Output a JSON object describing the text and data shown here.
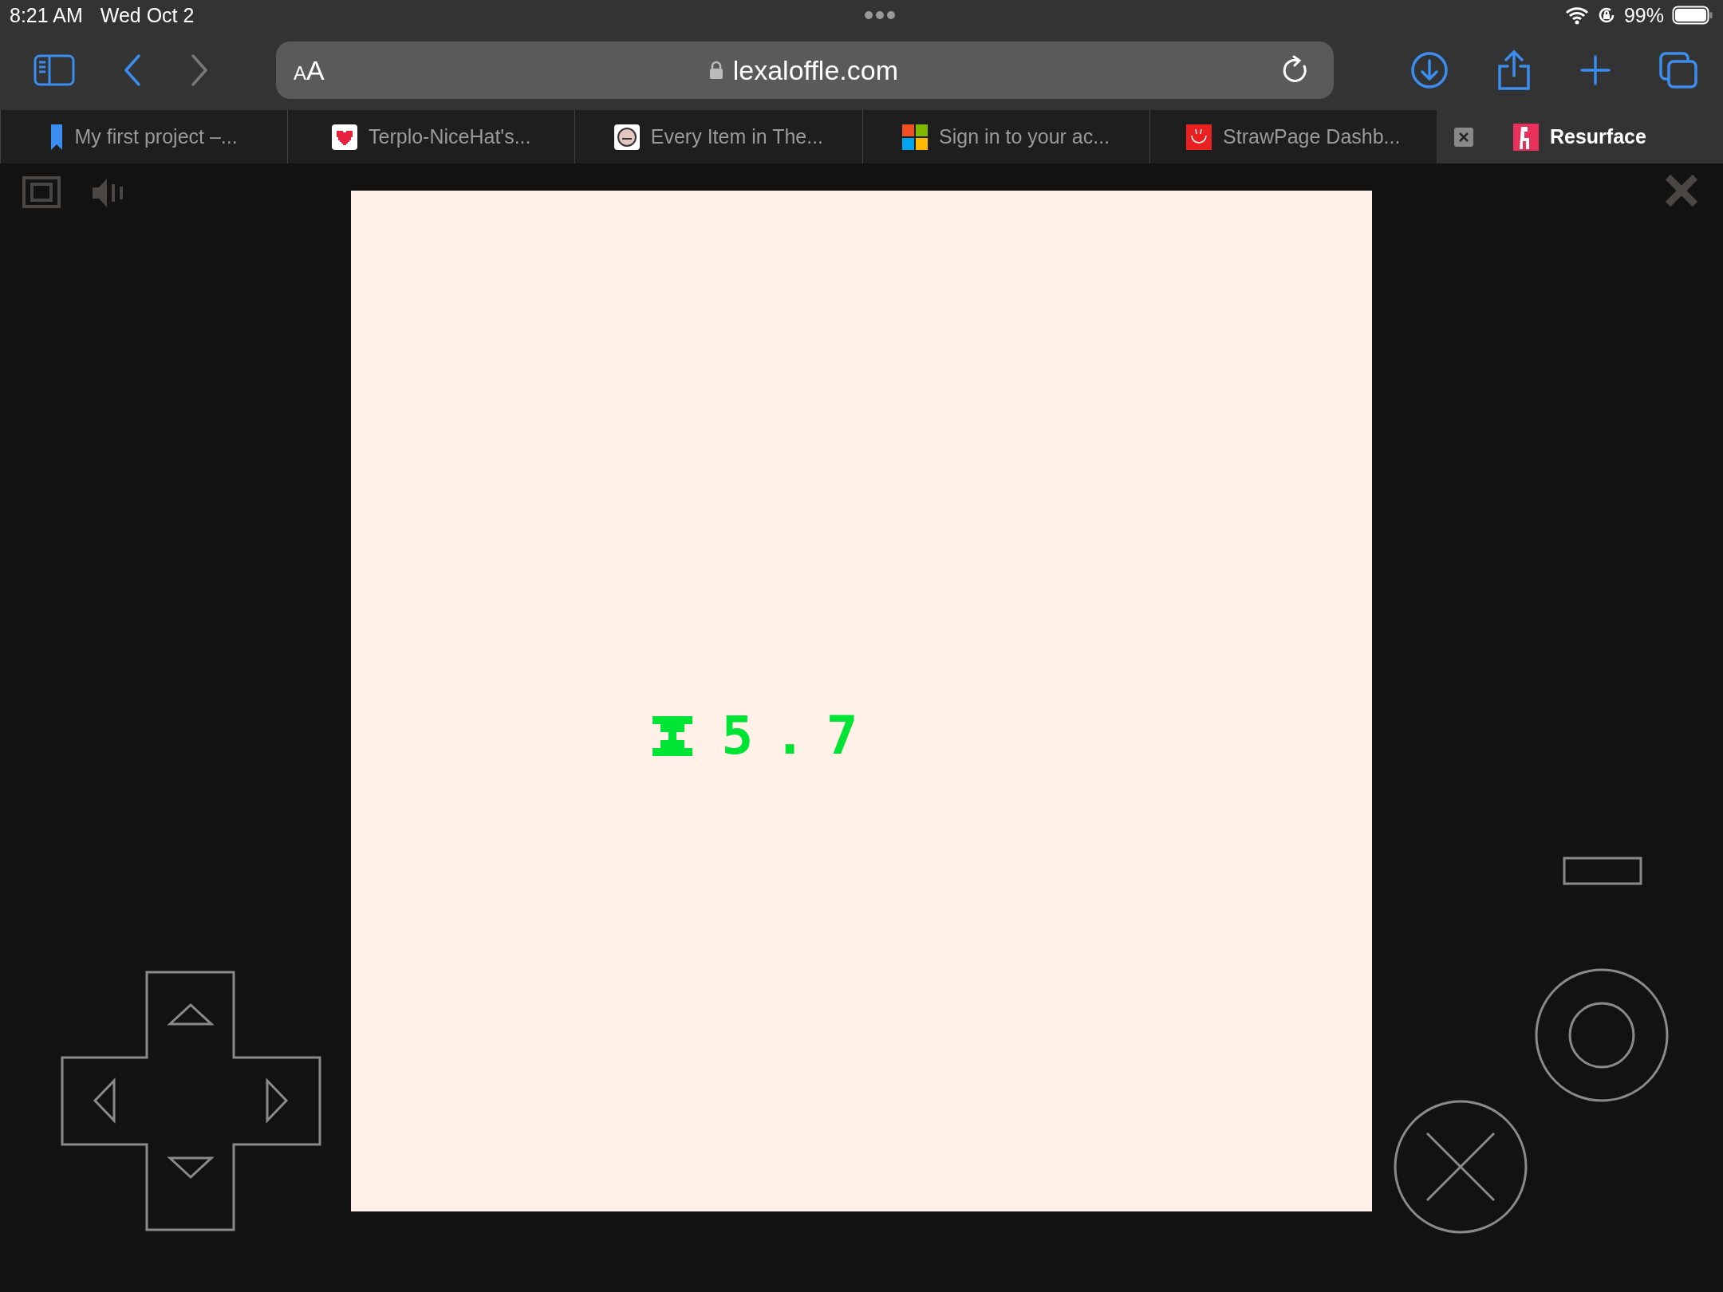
{
  "status_bar": {
    "time": "8:21 AM",
    "date": "Wed Oct 2",
    "battery": "99%"
  },
  "toolbar": {
    "text_size": "AA",
    "address": "lexaloffle.com",
    "back": {
      "disabled": false
    },
    "forward": {
      "disabled": true
    }
  },
  "tabs": [
    {
      "title": "My first project –...",
      "kind": "bookmark",
      "selected": false
    },
    {
      "title": "Terplo-NiceHat's...",
      "kind": "heart",
      "selected": false
    },
    {
      "title": "Every Item in The...",
      "kind": "face",
      "selected": false
    },
    {
      "title": "Sign in to your ac...",
      "kind": "squares",
      "selected": false
    },
    {
      "title": "StrawPage Dashb...",
      "kind": "smile",
      "selected": false
    },
    {
      "title": "Resurface",
      "kind": "figure",
      "selected": true
    }
  ],
  "game": {
    "timer": "5.7"
  }
}
